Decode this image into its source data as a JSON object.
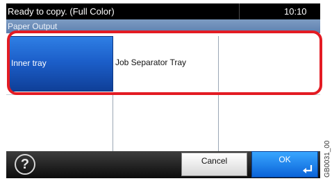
{
  "status_bar": {
    "message": "Ready to copy. (Full Color)",
    "time": "10:10"
  },
  "title_bar": {
    "title": "Paper Output"
  },
  "options": [
    {
      "label": "Inner tray",
      "selected": true
    },
    {
      "label": "Job Separator Tray",
      "selected": false
    }
  ],
  "footer": {
    "help_icon": "help-icon",
    "cancel_label": "Cancel",
    "ok_label": "OK",
    "enter_icon": "enter-arrow-icon"
  },
  "side_code": "GB0031_00",
  "colors": {
    "selected_button": "#1c5fca",
    "highlight": "#e31b23",
    "ok_button": "#0a63d8",
    "title_bar": "#6d8db8"
  }
}
